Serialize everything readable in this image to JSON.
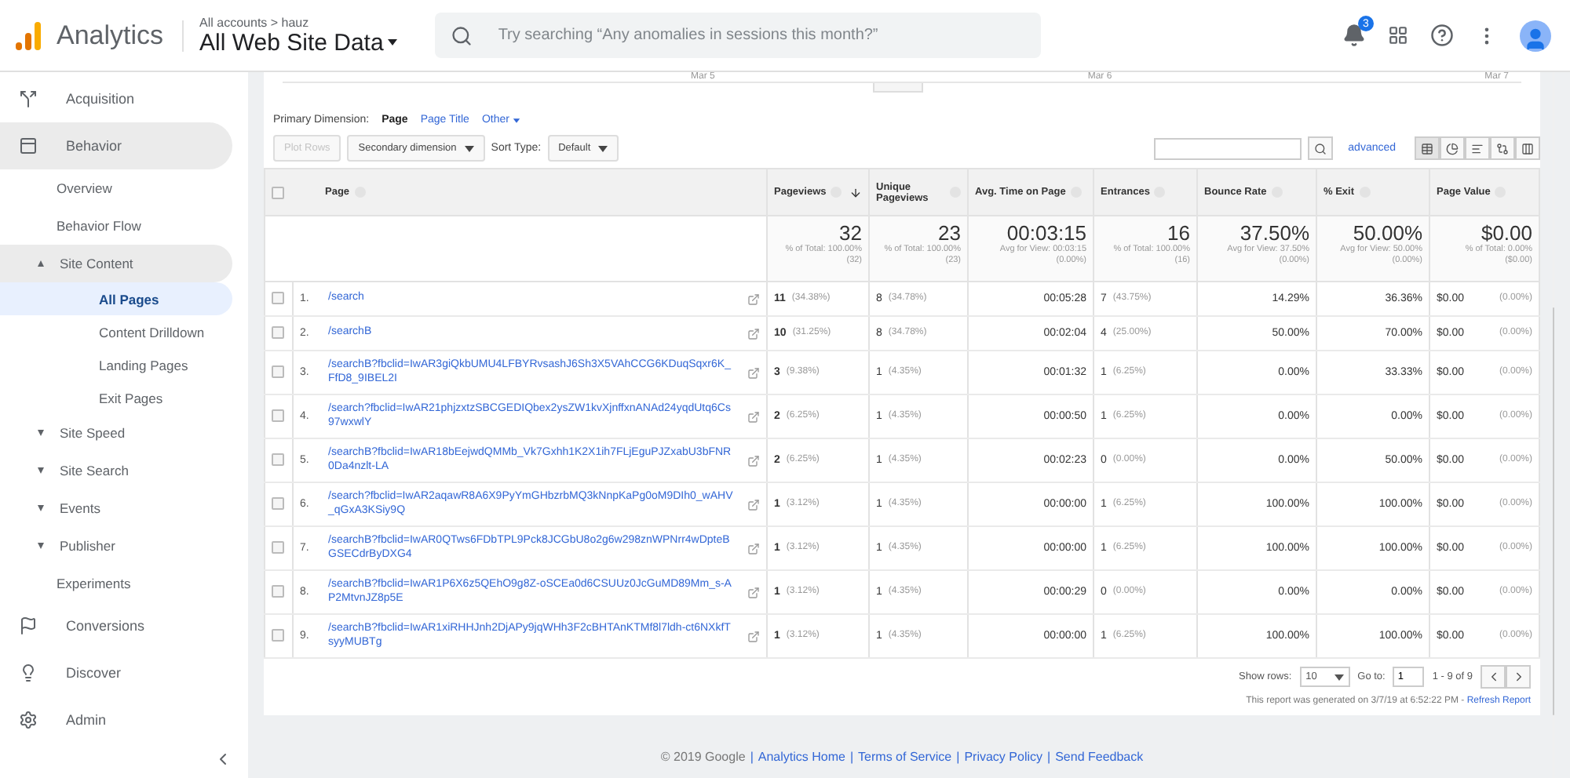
{
  "header": {
    "product": "Analytics",
    "breadcrumb": "All accounts > hauz",
    "view": "All Web Site Data",
    "search": {
      "placeholder": "Try searching “Any anomalies in sessions this month?”"
    },
    "notifications": "3"
  },
  "sidebar": {
    "items": [
      {
        "label": "Acquisition",
        "selected": false
      },
      {
        "label": "Behavior",
        "selected": true,
        "children": [
          {
            "label": "Overview",
            "selected": false
          },
          {
            "label": "Behavior Flow",
            "selected": false
          },
          {
            "label": "Site Content",
            "selected": true,
            "expanded": true,
            "children": [
              {
                "label": "All Pages",
                "selected": true
              },
              {
                "label": "Content Drilldown",
                "selected": false
              },
              {
                "label": "Landing Pages",
                "selected": false
              },
              {
                "label": "Exit Pages",
                "selected": false
              }
            ]
          },
          {
            "label": "Site Speed",
            "selected": false,
            "expanded": false
          },
          {
            "label": "Site Search",
            "selected": false,
            "expanded": false
          },
          {
            "label": "Events",
            "selected": false,
            "expanded": false
          },
          {
            "label": "Publisher",
            "selected": false,
            "expanded": false
          },
          {
            "label": "Experiments",
            "selected": false
          }
        ]
      },
      {
        "label": "Conversions",
        "selected": false
      },
      {
        "label": "Discover",
        "selected": false
      },
      {
        "label": "Admin",
        "selected": false
      }
    ]
  },
  "chart": {
    "x_labels": [
      "Mar 5",
      "Mar 6",
      "Mar 7"
    ]
  },
  "primary_dimension": {
    "label": "Primary Dimension:",
    "options": [
      {
        "label": "Page",
        "selected": true
      },
      {
        "label": "Page Title",
        "selected": false
      },
      {
        "label": "Other",
        "selected": false
      }
    ]
  },
  "toolbar": {
    "plot_rows": {
      "label": "Plot Rows",
      "disabled": true
    },
    "secondary": "Secondary dimension",
    "sort_label": "Sort Type:",
    "sort": "Default",
    "advanced": "advanced",
    "views": [
      {
        "kind": "table",
        "selected": true
      },
      {
        "kind": "pie",
        "selected": false
      },
      {
        "kind": "bars",
        "selected": false
      },
      {
        "kind": "compare",
        "selected": false
      },
      {
        "kind": "pivot",
        "selected": false
      }
    ]
  },
  "table": {
    "select_all": {
      "checked": false
    },
    "columns": [
      {
        "label": "Page",
        "sorted": false
      },
      {
        "label": "Pageviews",
        "sorted": true
      },
      {
        "label": "Unique Pageviews",
        "sorted": false
      },
      {
        "label": "Avg. Time on Page",
        "sorted": false
      },
      {
        "label": "Entrances",
        "sorted": false
      },
      {
        "label": "Bounce Rate",
        "sorted": false
      },
      {
        "label": "% Exit",
        "sorted": false
      },
      {
        "label": "Page Value",
        "sorted": false
      }
    ],
    "totals": [
      {
        "value": "32",
        "sub": "% of Total: 100.00% (32)"
      },
      {
        "value": "23",
        "sub": "% of Total: 100.00% (23)"
      },
      {
        "value": "00:03:15",
        "sub": "Avg for View: 00:03:15 (0.00%)"
      },
      {
        "value": "16",
        "sub": "% of Total: 100.00% (16)"
      },
      {
        "value": "37.50%",
        "sub": "Avg for View: 37.50% (0.00%)"
      },
      {
        "value": "50.00%",
        "sub": "Avg for View: 50.00% (0.00%)"
      },
      {
        "value": "$0.00",
        "sub": "% of Total: 0.00% ($0.00)"
      }
    ],
    "rows": [
      {
        "checked": false,
        "index": "1.",
        "cells": [
          {
            "value": "/search"
          },
          {
            "value": "11",
            "pct": "(34.38%)"
          },
          {
            "value": "8",
            "pct": "(34.78%)"
          },
          {
            "value": "00:05:28"
          },
          {
            "value": "7",
            "pct": "(43.75%)"
          },
          {
            "value": "14.29%"
          },
          {
            "value": "36.36%"
          },
          {
            "value": "$0.00",
            "pct": "(0.00%)"
          }
        ]
      },
      {
        "checked": false,
        "index": "2.",
        "cells": [
          {
            "value": "/searchB"
          },
          {
            "value": "10",
            "pct": "(31.25%)"
          },
          {
            "value": "8",
            "pct": "(34.78%)"
          },
          {
            "value": "00:02:04"
          },
          {
            "value": "4",
            "pct": "(25.00%)"
          },
          {
            "value": "50.00%"
          },
          {
            "value": "70.00%"
          },
          {
            "value": "$0.00",
            "pct": "(0.00%)"
          }
        ]
      },
      {
        "checked": false,
        "index": "3.",
        "cells": [
          {
            "value": "/searchB?fbclid=IwAR3giQkbUMU4LFBYRvsashJ6Sh3X5VAhCCG6KDuqSqxr6K_FfD8_9IBEL2I"
          },
          {
            "value": "3",
            "pct": "(9.38%)"
          },
          {
            "value": "1",
            "pct": "(4.35%)"
          },
          {
            "value": "00:01:32"
          },
          {
            "value": "1",
            "pct": "(6.25%)"
          },
          {
            "value": "0.00%"
          },
          {
            "value": "33.33%"
          },
          {
            "value": "$0.00",
            "pct": "(0.00%)"
          }
        ]
      },
      {
        "checked": false,
        "index": "4.",
        "cells": [
          {
            "value": "/search?fbclid=IwAR21phjzxtzSBCGEDIQbex2ysZW1kvXjnffxnANAd24yqdUtq6Cs97wxwlY"
          },
          {
            "value": "2",
            "pct": "(6.25%)"
          },
          {
            "value": "1",
            "pct": "(4.35%)"
          },
          {
            "value": "00:00:50"
          },
          {
            "value": "1",
            "pct": "(6.25%)"
          },
          {
            "value": "0.00%"
          },
          {
            "value": "0.00%"
          },
          {
            "value": "$0.00",
            "pct": "(0.00%)"
          }
        ]
      },
      {
        "checked": false,
        "index": "5.",
        "cells": [
          {
            "value": "/searchB?fbclid=IwAR18bEejwdQMMb_Vk7Gxhh1K2X1ih7FLjEguPJZxabU3bFNR0Da4nzlt-LA"
          },
          {
            "value": "2",
            "pct": "(6.25%)"
          },
          {
            "value": "1",
            "pct": "(4.35%)"
          },
          {
            "value": "00:02:23"
          },
          {
            "value": "0",
            "pct": "(0.00%)"
          },
          {
            "value": "0.00%"
          },
          {
            "value": "50.00%"
          },
          {
            "value": "$0.00",
            "pct": "(0.00%)"
          }
        ]
      },
      {
        "checked": false,
        "index": "6.",
        "cells": [
          {
            "value": "/search?fbclid=IwAR2aqawR8A6X9PyYmGHbzrbMQ3kNnpKaPg0oM9DIh0_wAHV_qGxA3KSiy9Q"
          },
          {
            "value": "1",
            "pct": "(3.12%)"
          },
          {
            "value": "1",
            "pct": "(4.35%)"
          },
          {
            "value": "00:00:00"
          },
          {
            "value": "1",
            "pct": "(6.25%)"
          },
          {
            "value": "100.00%"
          },
          {
            "value": "100.00%"
          },
          {
            "value": "$0.00",
            "pct": "(0.00%)"
          }
        ]
      },
      {
        "checked": false,
        "index": "7.",
        "cells": [
          {
            "value": "/searchB?fbclid=IwAR0QTws6FDbTPL9Pck8JCGbU8o2g6w298znWPNrr4wDpteBGSECdrByDXG4"
          },
          {
            "value": "1",
            "pct": "(3.12%)"
          },
          {
            "value": "1",
            "pct": "(4.35%)"
          },
          {
            "value": "00:00:00"
          },
          {
            "value": "1",
            "pct": "(6.25%)"
          },
          {
            "value": "100.00%"
          },
          {
            "value": "100.00%"
          },
          {
            "value": "$0.00",
            "pct": "(0.00%)"
          }
        ]
      },
      {
        "checked": false,
        "index": "8.",
        "cells": [
          {
            "value": "/searchB?fbclid=IwAR1P6X6z5QEhO9g8Z-oSCEa0d6CSUUz0JcGuMD89Mm_s-AP2MtvnJZ8p5E"
          },
          {
            "value": "1",
            "pct": "(3.12%)"
          },
          {
            "value": "1",
            "pct": "(4.35%)"
          },
          {
            "value": "00:00:29"
          },
          {
            "value": "0",
            "pct": "(0.00%)"
          },
          {
            "value": "0.00%"
          },
          {
            "value": "0.00%"
          },
          {
            "value": "$0.00",
            "pct": "(0.00%)"
          }
        ]
      },
      {
        "checked": false,
        "index": "9.",
        "cells": [
          {
            "value": "/searchB?fbclid=IwAR1xiRHHJnh2DjAPy9jqWHh3F2cBHTAnKTMf8l7ldh-ct6NXkfTsyyMUBTg"
          },
          {
            "value": "1",
            "pct": "(3.12%)"
          },
          {
            "value": "1",
            "pct": "(4.35%)"
          },
          {
            "value": "00:00:00"
          },
          {
            "value": "1",
            "pct": "(6.25%)"
          },
          {
            "value": "100.00%"
          },
          {
            "value": "100.00%"
          },
          {
            "value": "$0.00",
            "pct": "(0.00%)"
          }
        ]
      }
    ]
  },
  "pager": {
    "show_rows_label": "Show rows:",
    "rows": "10",
    "goto_label": "Go to:",
    "goto": "1",
    "range": "1 - 9 of 9"
  },
  "generated": {
    "text": "This report was generated on 3/7/19 at 6:52:22 PM -",
    "link": "Refresh Report"
  },
  "footer": {
    "copyright": "© 2019 Google",
    "separator": "|",
    "links": [
      "Analytics Home",
      "Terms of Service",
      "Privacy Policy",
      "Send Feedback"
    ]
  }
}
